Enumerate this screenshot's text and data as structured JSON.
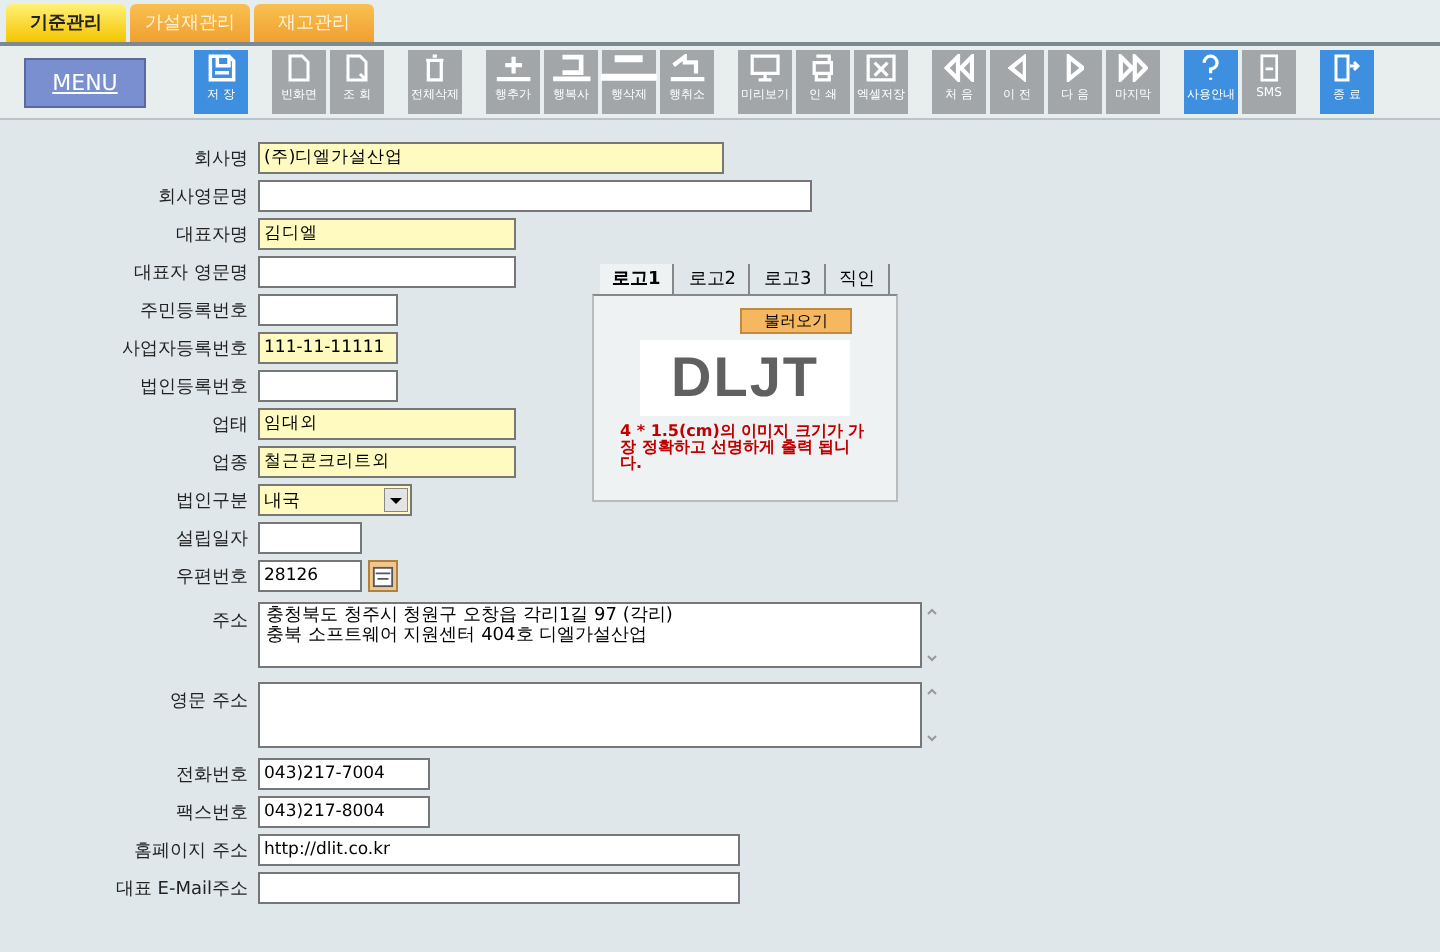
{
  "tabs": [
    {
      "label": "기준관리",
      "selected": true
    },
    {
      "label": "가설재관리",
      "selected": false
    },
    {
      "label": "재고관리",
      "selected": false
    }
  ],
  "toolbar": {
    "menu_label": "MENU",
    "groups": [
      [
        {
          "label": "저 장",
          "kind": "accent"
        }
      ],
      [
        {
          "label": "빈화면",
          "kind": "plain"
        },
        {
          "label": "조 회",
          "kind": "plain"
        }
      ],
      [
        {
          "label": "전체삭제",
          "kind": "plain"
        }
      ],
      [
        {
          "label": "행추가",
          "kind": "plain"
        },
        {
          "label": "행복사",
          "kind": "plain"
        },
        {
          "label": "행삭제",
          "kind": "plain"
        },
        {
          "label": "행취소",
          "kind": "plain"
        }
      ],
      [
        {
          "label": "미리보기",
          "kind": "plain"
        },
        {
          "label": "인 쇄",
          "kind": "plain"
        },
        {
          "label": "엑셀저장",
          "kind": "plain"
        }
      ],
      [
        {
          "label": "처 음",
          "kind": "plain"
        },
        {
          "label": "이 전",
          "kind": "plain"
        },
        {
          "label": "다 음",
          "kind": "plain"
        },
        {
          "label": "마지막",
          "kind": "plain"
        }
      ],
      [
        {
          "label": "사용안내",
          "kind": "accent"
        },
        {
          "label": "SMS",
          "kind": "plain"
        }
      ],
      [
        {
          "label": "종 료",
          "kind": "accent"
        }
      ]
    ]
  },
  "fields": [
    {
      "label": "회사명",
      "kind": "text",
      "value": "(주)디엘가설산업",
      "highlighted": true
    },
    {
      "label": "회사영문명",
      "kind": "text",
      "highlighted": false
    },
    {
      "label": "대표자명",
      "kind": "text",
      "value": "김디엘",
      "highlighted": true
    },
    {
      "label": "대표자 영문명",
      "kind": "text",
      "highlighted": false
    },
    {
      "label": "주민등록번호",
      "kind": "text",
      "highlighted": false
    },
    {
      "label": "사업자등록번호",
      "kind": "text",
      "value": "111-11-11111",
      "highlighted": true
    },
    {
      "label": "법인등록번호",
      "kind": "text",
      "highlighted": false
    },
    {
      "label": "업태",
      "kind": "text",
      "value": "임대외",
      "highlighted": true
    },
    {
      "label": "업종",
      "kind": "text",
      "value": "철근콘크리트외",
      "highlighted": true
    },
    {
      "label": "법인구분",
      "kind": "select",
      "value": "내국",
      "highlighted": true
    },
    {
      "label": "설립일자",
      "kind": "text",
      "highlighted": false
    },
    {
      "label": "우편번호",
      "kind": "zip",
      "value": "28126",
      "highlighted": false
    },
    {
      "label": "주소",
      "kind": "textarea",
      "value": "충청북도 청주시 청원구 오창읍 각리1길 97 (각리)\n충북 소프트웨어 지원센터 404호 디엘가설산업"
    },
    {
      "label": "영문 주소",
      "kind": "textarea"
    },
    {
      "label": "전화번호",
      "kind": "text",
      "value": "043)217-7004",
      "highlighted": false
    },
    {
      "label": "팩스번호",
      "kind": "text",
      "value": "043)217-8004",
      "highlighted": false
    },
    {
      "label": "홈페이지 주소",
      "kind": "text",
      "value": "http://dlit.co.kr",
      "highlighted": false
    },
    {
      "label": "대표 E-Mail주소",
      "kind": "text",
      "highlighted": false
    }
  ],
  "logo_panel": {
    "tabs": [
      {
        "label": "로고1",
        "selected": true
      },
      {
        "label": "로고2",
        "selected": false
      },
      {
        "label": "로고3",
        "selected": false
      },
      {
        "label": "직인",
        "selected": false
      }
    ],
    "load_button": "불러오기",
    "logo_text": "DLJT",
    "note": "4 * 1.5(cm)의 이미지 크기가 가장 정확하고 선명하게 출력 됩니다."
  }
}
